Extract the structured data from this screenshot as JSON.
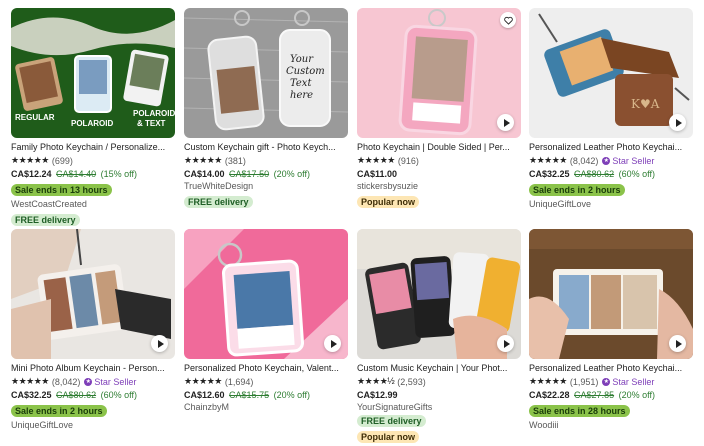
{
  "listings": [
    {
      "title": "Family Photo Keychain / Personalize...",
      "stars": "★★★★★",
      "reviews": "(699)",
      "star_seller": "",
      "price": "CA$12.24",
      "original_price": "CA$14.40",
      "discount": "(15% off)",
      "sale_badge": "Sale ends in 13 hours",
      "shop": "WestCoastCreated",
      "free_delivery": "FREE delivery",
      "popular": "",
      "image_text": [
        "REGULAR",
        "POLAROID",
        "POLAROID",
        "& TEXT"
      ],
      "has_video": false,
      "has_fav": false
    },
    {
      "title": "Custom Keychain gift - Photo Keych...",
      "stars": "★★★★★",
      "reviews": "(381)",
      "star_seller": "",
      "price": "CA$14.00",
      "original_price": "CA$17.50",
      "discount": "(20% off)",
      "sale_badge": "",
      "shop": "TrueWhiteDesign",
      "free_delivery": "FREE delivery",
      "popular": "",
      "image_text": [
        "Your",
        "Custom",
        "Text",
        "here"
      ],
      "has_video": false,
      "has_fav": false
    },
    {
      "title": "Photo Keychain | Double Sided | Per...",
      "stars": "★★★★★",
      "reviews": "(916)",
      "star_seller": "",
      "price": "CA$11.00",
      "original_price": "",
      "discount": "",
      "sale_badge": "",
      "shop": "stickersbysuzie",
      "free_delivery": "",
      "popular": "Popular now",
      "image_text": [],
      "has_video": true,
      "has_fav": true
    },
    {
      "title": "Personalized Leather Photo Keychai...",
      "stars": "★★★★★",
      "reviews": "(8,042)",
      "star_seller": "Star Seller",
      "price": "CA$32.25",
      "original_price": "CA$80.62",
      "discount": "(60% off)",
      "sale_badge": "Sale ends in 2 hours",
      "shop": "UniqueGiftLove",
      "free_delivery": "",
      "popular": "",
      "image_text": [
        "K♥A"
      ],
      "has_video": true,
      "has_fav": false
    },
    {
      "title": "Mini Photo Album Keychain - Person...",
      "stars": "★★★★★",
      "reviews": "(8,042)",
      "star_seller": "Star Seller",
      "price": "CA$32.25",
      "original_price": "CA$80.62",
      "discount": "(60% off)",
      "sale_badge": "Sale ends in 2 hours",
      "shop": "UniqueGiftLove",
      "free_delivery": "",
      "popular": "",
      "image_text": [],
      "has_video": true,
      "has_fav": false
    },
    {
      "title": "Personalized Photo Keychain, Valent...",
      "stars": "★★★★★",
      "reviews": "(1,694)",
      "star_seller": "",
      "price": "CA$12.60",
      "original_price": "CA$15.75",
      "discount": "(20% off)",
      "sale_badge": "",
      "shop": "ChainzbyM",
      "free_delivery": "",
      "popular": "",
      "image_text": [],
      "has_video": true,
      "has_fav": false
    },
    {
      "title": "Custom Music Keychain | Your Phot...",
      "stars": "★★★★½",
      "reviews": "(2,593)",
      "star_seller": "",
      "price": "CA$12.99",
      "original_price": "",
      "discount": "",
      "sale_badge": "",
      "shop": "YourSignatureGifts",
      "free_delivery": "FREE delivery",
      "popular": "Popular now",
      "image_text": [],
      "has_video": true,
      "has_fav": false
    },
    {
      "title": "Personalized Leather Photo Keychai...",
      "stars": "★★★★★",
      "reviews": "(1,951)",
      "star_seller": "Star Seller",
      "price": "CA$22.28",
      "original_price": "CA$27.85",
      "discount": "(20% off)",
      "sale_badge": "Sale ends in 28 hours",
      "shop": "Woodiii",
      "free_delivery": "",
      "popular": "",
      "image_text": [],
      "has_video": true,
      "has_fav": false
    }
  ],
  "icons": {
    "play": "play-icon",
    "heart": "heart-icon",
    "star_seller": "star-seller-icon"
  },
  "colors": {
    "sale_pill": "#8bc34a",
    "free_pill": "#d4ecd0",
    "popular_pill": "#fde6b4",
    "discount_green": "#2e7d32",
    "star_seller_purple": "#7e3fb8"
  }
}
